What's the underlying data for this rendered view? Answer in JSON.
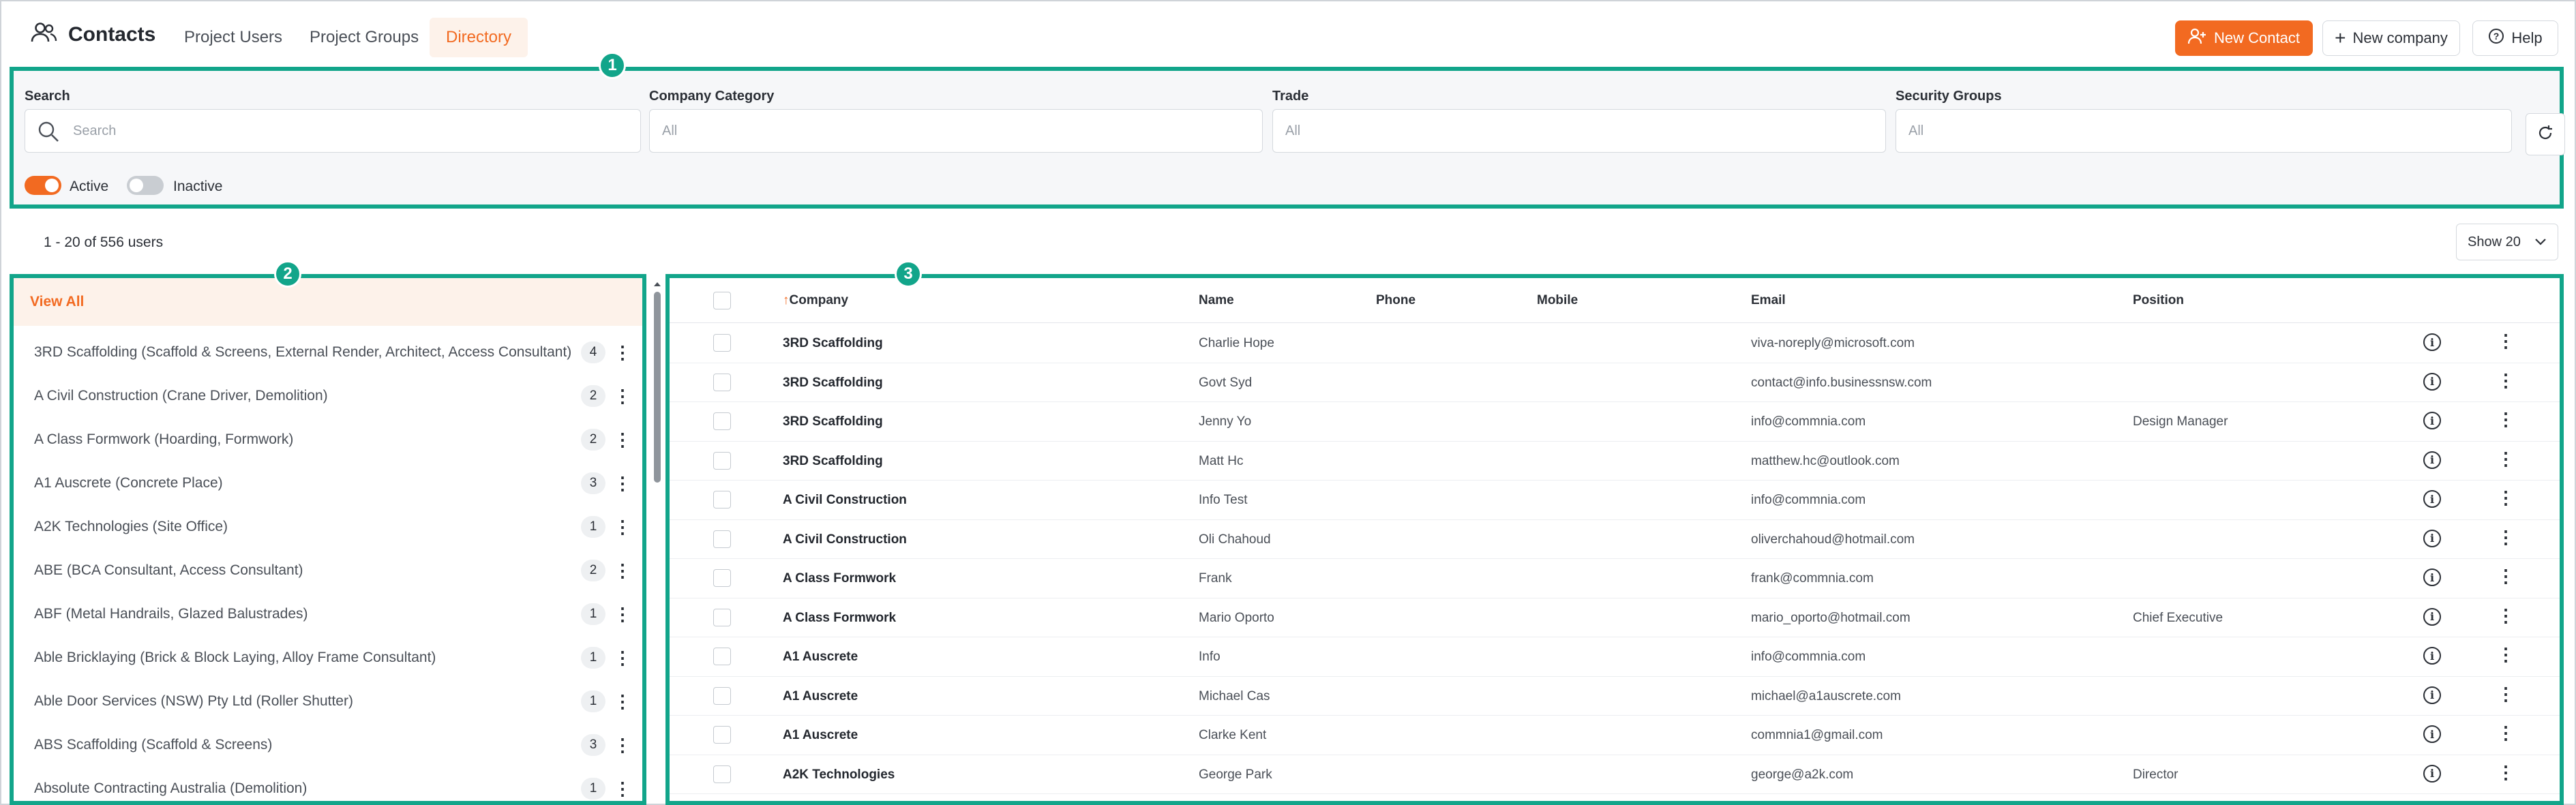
{
  "header": {
    "title": "Contacts",
    "tabs": [
      {
        "label": "Project Users",
        "active": false
      },
      {
        "label": "Project Groups",
        "active": false
      },
      {
        "label": "Directory",
        "active": true
      }
    ],
    "new_contact": "New Contact",
    "new_company": "New company",
    "help": "Help"
  },
  "colors": {
    "accent": "#f26a21",
    "highlight": "#12a58a"
  },
  "markers": [
    "1",
    "2",
    "3"
  ],
  "filters": {
    "search_label": "Search",
    "search_placeholder": "Search",
    "category_label": "Company Category",
    "category_value": "All",
    "trade_label": "Trade",
    "trade_value": "All",
    "groups_label": "Security Groups",
    "groups_value": "All",
    "active_label": "Active",
    "inactive_label": "Inactive"
  },
  "summary": {
    "count": "1 - 20 of 556 users",
    "show": "Show 20"
  },
  "companies": {
    "view_all": "View All",
    "items": [
      {
        "name": "3RD Scaffolding (Scaffold & Screens, External Render, Architect, Access Consultant)",
        "count": "4"
      },
      {
        "name": "A Civil Construction (Crane Driver, Demolition)",
        "count": "2"
      },
      {
        "name": "A Class Formwork (Hoarding, Formwork)",
        "count": "2"
      },
      {
        "name": "A1 Auscrete (Concrete Place)",
        "count": "3"
      },
      {
        "name": "A2K Technologies (Site Office)",
        "count": "1"
      },
      {
        "name": "ABE (BCA Consultant, Access Consultant)",
        "count": "2"
      },
      {
        "name": "ABF (Metal Handrails, Glazed Balustrades)",
        "count": "1"
      },
      {
        "name": "Able Bricklaying (Brick & Block Laying, Alloy Frame Consultant)",
        "count": "1"
      },
      {
        "name": "Able Door Services (NSW) Pty Ltd (Roller Shutter)",
        "count": "1"
      },
      {
        "name": "ABS Scaffolding (Scaffold & Screens)",
        "count": "3"
      },
      {
        "name": "Absolute Contracting Australia (Demolition)",
        "count": "1"
      }
    ]
  },
  "table": {
    "columns": {
      "company": "Company",
      "sort_arrow": "↑",
      "name": "Name",
      "phone": "Phone",
      "mobile": "Mobile",
      "email": "Email",
      "position": "Position"
    },
    "rows": [
      {
        "company": "3RD Scaffolding",
        "name": "Charlie Hope",
        "email": "viva-noreply@microsoft.com",
        "position": ""
      },
      {
        "company": "3RD Scaffolding",
        "name": "Govt Syd",
        "email": "contact@info.businessnsw.com",
        "position": ""
      },
      {
        "company": "3RD Scaffolding",
        "name": "Jenny Yo",
        "email": "info@commnia.com",
        "position": "Design Manager"
      },
      {
        "company": "3RD Scaffolding",
        "name": "Matt Hc",
        "email": "matthew.hc@outlook.com",
        "position": ""
      },
      {
        "company": "A Civil Construction",
        "name": "Info Test",
        "email": "info@commnia.com",
        "position": ""
      },
      {
        "company": "A Civil Construction",
        "name": "Oli Chahoud",
        "email": "oliverchahoud@hotmail.com",
        "position": ""
      },
      {
        "company": "A Class Formwork",
        "name": "Frank",
        "email": "frank@commnia.com",
        "position": ""
      },
      {
        "company": "A Class Formwork",
        "name": "Mario Oporto",
        "email": "mario_oporto@hotmail.com",
        "position": "Chief Executive"
      },
      {
        "company": "A1 Auscrete",
        "name": "Info",
        "email": "info@commnia.com",
        "position": ""
      },
      {
        "company": "A1 Auscrete",
        "name": "Michael Cas",
        "email": "michael@a1auscrete.com",
        "position": ""
      },
      {
        "company": "A1 Auscrete",
        "name": "Clarke Kent",
        "email": "commnia1@gmail.com",
        "position": ""
      },
      {
        "company": "A2K Technologies",
        "name": "George Park",
        "email": "george@a2k.com",
        "position": "Director"
      }
    ]
  }
}
